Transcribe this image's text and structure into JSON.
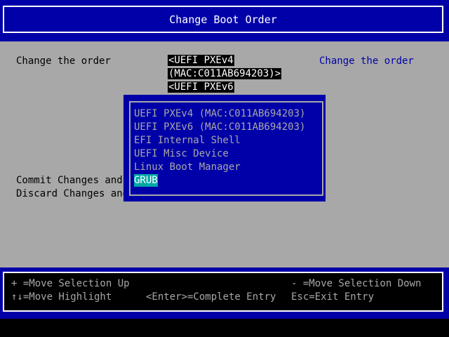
{
  "header": {
    "title": "Change Boot Order"
  },
  "form": {
    "row1_label": "Change the order",
    "value_lines": [
      "<UEFI PXEv4",
      "(MAC:C011AB694203)>",
      "<UEFI PXEv6"
    ],
    "help_text": "Change the order",
    "row2_label": "Commit Changes and",
    "row3_label": "Discard Changes and"
  },
  "popup": {
    "items": [
      "UEFI PXEv4 (MAC:C011AB694203)",
      "UEFI PXEv6 (MAC:C011AB694203)",
      "EFI Internal Shell",
      "UEFI Misc Device",
      "Linux Boot Manager",
      "GRUB"
    ],
    "selected": "GRUB"
  },
  "footer": {
    "move_up": "+ =Move Selection Up",
    "move_down": "- =Move Selection Down",
    "move_highlight": "↑↓=Move Highlight",
    "complete_entry": "<Enter>=Complete Entry",
    "exit_entry": "Esc=Exit Entry"
  },
  "colors": {
    "header_blue": "#0000a8",
    "body_gray": "#a8a8a8",
    "highlight_cyan": "#00a8a8",
    "help_text_blue": "#0000a8"
  }
}
